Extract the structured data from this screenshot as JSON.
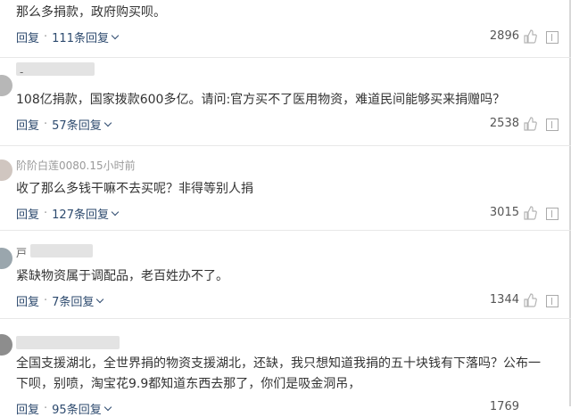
{
  "comments": [
    {
      "username": "",
      "text": "那么多捐款，政府购买呗。",
      "reply_label": "回复",
      "replies_label": "111条回复",
      "likes": "2896"
    },
    {
      "username": "-",
      "text": "108亿捐款，国家拨款600多亿。请问:官方买不了医用物资，难道民间能够买来捐赠吗？",
      "reply_label": "回复",
      "replies_label": "57条回复",
      "likes": "2538"
    },
    {
      "username": "阶阶白莲0080.15小时前",
      "text": "收了那么多钱干嘛不去买呢？非得等别人捐",
      "reply_label": "回复",
      "replies_label": "127条回复",
      "likes": "3015"
    },
    {
      "username": "戸",
      "text": "紧缺物资属于调配品，老百姓办不了。",
      "reply_label": "回复",
      "replies_label": "7条回复",
      "likes": "1344"
    },
    {
      "username": "",
      "text": "全国支援湖北，全世界捐的物资支援湖北，还缺，我只想知道我捐的五十块钱有下落吗？公布一下呗，别喷，淘宝花9.9都知道东西去那了，你们是吸金洞吊，",
      "reply_label": "回复",
      "replies_label": "95条回复",
      "likes": "1769"
    }
  ],
  "icons": {
    "like": "thumbs-up-icon",
    "report": "report-icon",
    "expand": "chevron-down-icon"
  },
  "colors": {
    "link": "#2d4a6e",
    "text": "#333333",
    "muted": "#666666"
  }
}
